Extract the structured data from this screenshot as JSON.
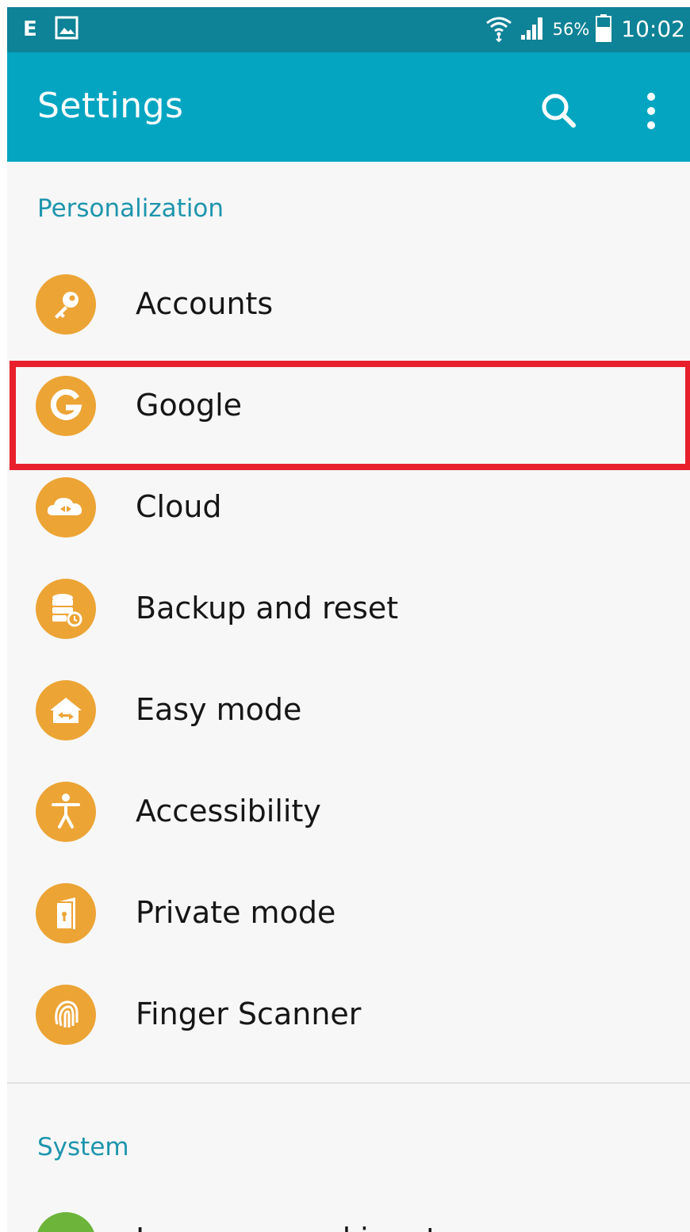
{
  "status_bar": {
    "network_letter": "E",
    "battery_percent": "56%",
    "time": "10:02",
    "background": "#0e8296",
    "icons": [
      "gallery-notification-icon",
      "wifi-icon",
      "signal-icon",
      "battery-icon"
    ]
  },
  "app_bar": {
    "title": "Settings",
    "background": "#04a5c1",
    "actions": [
      "search-icon",
      "more-options-icon"
    ]
  },
  "personalization": {
    "header": "Personalization",
    "items": [
      {
        "label": "Accounts",
        "icon": "key-icon"
      },
      {
        "label": "Google",
        "icon": "google-icon",
        "highlighted": true
      },
      {
        "label": "Cloud",
        "icon": "cloud-icon"
      },
      {
        "label": "Backup and reset",
        "icon": "backup-icon"
      },
      {
        "label": "Easy mode",
        "icon": "easy-mode-icon"
      },
      {
        "label": "Accessibility",
        "icon": "accessibility-icon"
      },
      {
        "label": "Private mode",
        "icon": "private-mode-icon"
      },
      {
        "label": "Finger Scanner",
        "icon": "fingerprint-icon"
      }
    ]
  },
  "system": {
    "header": "System",
    "partial_item": {
      "label": "Language and input",
      "icon": "keyboard-icon"
    }
  },
  "colors": {
    "accent": "#1e95ad",
    "icon_orange": "#eca435",
    "icon_green": "#6cb43a",
    "highlight": "#e8202c"
  }
}
